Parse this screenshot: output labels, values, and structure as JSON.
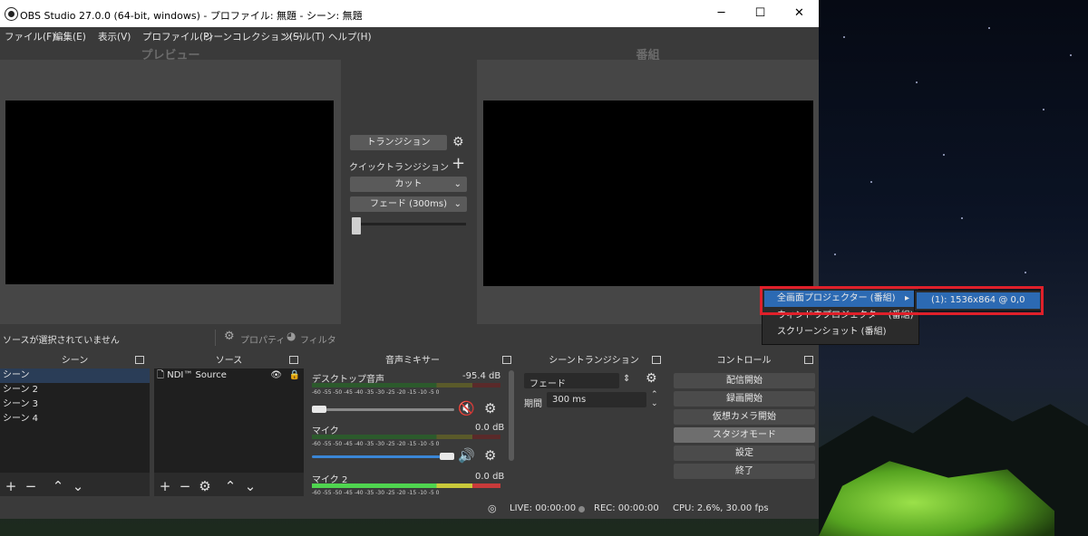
{
  "window": {
    "title": "OBS Studio 27.0.0 (64-bit, windows) - プロファイル: 無題 - シーン: 無題",
    "controls": {
      "minimize": "─",
      "maximize": "☐",
      "close": "✕"
    }
  },
  "menubar": [
    "ファイル(F)",
    "編集(E)",
    "表示(V)",
    "プロファイル(P)",
    "シーンコレクション(S)",
    "ツール(T)",
    "ヘルプ(H)"
  ],
  "preview": {
    "title": "プレビュー",
    "no_source": "ソースが選択されていません",
    "properties": "プロパティ",
    "filters": "フィルタ"
  },
  "program": {
    "title": "番組"
  },
  "transition_panel": {
    "transition_button": "トランジション",
    "quick_transitions": "クイックトランジション",
    "cut": "カット",
    "fade": "フェード (300ms)",
    "tbar_position": 0
  },
  "scenes": {
    "title": "シーン",
    "items": [
      "シーン",
      "シーン 2",
      "シーン 3",
      "シーン 4"
    ],
    "selected": 0
  },
  "sources": {
    "title": "ソース",
    "items": [
      "NDI™ Source"
    ]
  },
  "mixer": {
    "title": "音声ミキサー",
    "ticks": "-60 -55 -50 -45 -40 -35 -30 -25 -20 -15 -10 -5 0",
    "channels": [
      {
        "name": "デスクトップ音声",
        "level": "-95.4 dB",
        "muted": true,
        "volume_fraction": 0.08
      },
      {
        "name": "マイク",
        "level": "0.0 dB",
        "muted": false,
        "volume_fraction": 1.0
      },
      {
        "name": "マイク 2",
        "level": "0.0 dB"
      }
    ]
  },
  "scene_transitions": {
    "title": "シーントランジション",
    "selected": "フェード",
    "duration_label": "期間",
    "duration": "300 ms"
  },
  "controls": {
    "title": "コントロール",
    "buttons": [
      "配信開始",
      "録画開始",
      "仮想カメラ開始",
      "スタジオモード",
      "設定",
      "終了"
    ],
    "active": 3
  },
  "statusbar": {
    "live": "LIVE: 00:00:00",
    "rec": "REC: 00:00:00",
    "cpu": "CPU: 2.6%, 30.00 fps"
  },
  "context_menu": {
    "items": [
      "全画面プロジェクター (番組)",
      "ウィンドウプロジェクター (番組)",
      "スクリーンショット (番組)"
    ],
    "highlighted": 0,
    "submenu": [
      "(1): 1536x864 @ 0,0"
    ]
  },
  "colors": {
    "accent": "#2c6ab3",
    "selection": "#2a3d57",
    "highlight_box": "#e0202a",
    "muted_red": "#d3222a",
    "volume_blue": "#3a86d6"
  }
}
